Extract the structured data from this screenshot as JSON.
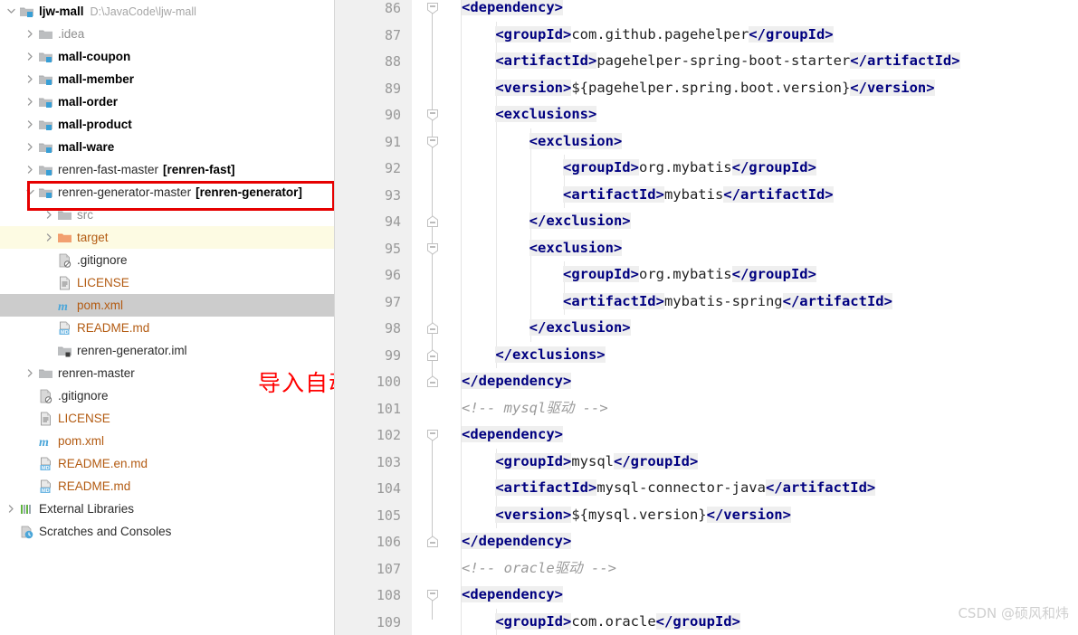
{
  "annotation": {
    "callout_text": "导入自动生成代码的文件",
    "callout_color": "#ff0000",
    "highlight_box_color": "#e60000"
  },
  "watermark": {
    "text": "CSDN @硕风和炜"
  },
  "project_tree": {
    "items": [
      {
        "indent": 0,
        "arrow": "down",
        "icon": "module-folder-icon",
        "label": "ljw-mall",
        "style": "bold",
        "path": "D:\\JavaCode\\ljw-mall",
        "state": "normal"
      },
      {
        "indent": 1,
        "arrow": "right",
        "icon": "folder-icon",
        "label": ".idea",
        "style": "gray",
        "path": "",
        "state": "normal"
      },
      {
        "indent": 1,
        "arrow": "right",
        "icon": "module-folder-icon",
        "label": "mall-coupon",
        "style": "bold",
        "path": "",
        "state": "normal"
      },
      {
        "indent": 1,
        "arrow": "right",
        "icon": "module-folder-icon",
        "label": "mall-member",
        "style": "bold",
        "path": "",
        "state": "normal"
      },
      {
        "indent": 1,
        "arrow": "right",
        "icon": "module-folder-icon",
        "label": "mall-order",
        "style": "bold",
        "path": "",
        "state": "normal"
      },
      {
        "indent": 1,
        "arrow": "right",
        "icon": "module-folder-icon",
        "label": "mall-product",
        "style": "bold",
        "path": "",
        "state": "normal"
      },
      {
        "indent": 1,
        "arrow": "right",
        "icon": "module-folder-icon",
        "label": "mall-ware",
        "style": "bold",
        "path": "",
        "state": "normal"
      },
      {
        "indent": 1,
        "arrow": "right",
        "icon": "module-folder-icon",
        "label": "renren-fast-master",
        "style": "plain",
        "module": "[renren-fast]",
        "path": "",
        "state": "normal"
      },
      {
        "indent": 1,
        "arrow": "down",
        "icon": "module-folder-icon",
        "label": "renren-generator-master",
        "style": "plain",
        "module": "[renren-generator]",
        "path": "",
        "state": "normal"
      },
      {
        "indent": 2,
        "arrow": "right",
        "icon": "folder-icon",
        "label": "src",
        "style": "gray",
        "path": "",
        "state": "normal"
      },
      {
        "indent": 2,
        "arrow": "right",
        "icon": "target-folder-icon",
        "label": "target",
        "style": "orange-folder",
        "path": "",
        "state": "highlight"
      },
      {
        "indent": 2,
        "arrow": "none",
        "icon": "gitignore-icon",
        "label": ".gitignore",
        "style": "plain",
        "path": "",
        "state": "normal"
      },
      {
        "indent": 2,
        "arrow": "none",
        "icon": "text-file-icon",
        "label": "LICENSE",
        "style": "orange",
        "path": "",
        "state": "normal"
      },
      {
        "indent": 2,
        "arrow": "none",
        "icon": "maven-pom-icon",
        "label": "pom.xml",
        "style": "orange",
        "path": "",
        "state": "selected"
      },
      {
        "indent": 2,
        "arrow": "none",
        "icon": "markdown-icon",
        "label": "README.md",
        "style": "orange",
        "path": "",
        "state": "normal"
      },
      {
        "indent": 2,
        "arrow": "none",
        "icon": "iml-icon",
        "label": "renren-generator.iml",
        "style": "plain",
        "path": "",
        "state": "normal"
      },
      {
        "indent": 1,
        "arrow": "right",
        "icon": "folder-icon",
        "label": "renren-master",
        "style": "plain",
        "path": "",
        "state": "normal"
      },
      {
        "indent": 1,
        "arrow": "none",
        "icon": "gitignore-icon",
        "label": ".gitignore",
        "style": "plain",
        "path": "",
        "state": "normal"
      },
      {
        "indent": 1,
        "arrow": "none",
        "icon": "text-file-icon",
        "label": "LICENSE",
        "style": "orange",
        "path": "",
        "state": "normal"
      },
      {
        "indent": 1,
        "arrow": "none",
        "icon": "maven-pom-icon",
        "label": "pom.xml",
        "style": "orange",
        "path": "",
        "state": "normal"
      },
      {
        "indent": 1,
        "arrow": "none",
        "icon": "markdown-icon",
        "label": "README.en.md",
        "style": "orange",
        "path": "",
        "state": "normal"
      },
      {
        "indent": 1,
        "arrow": "none",
        "icon": "markdown-icon",
        "label": "README.md",
        "style": "orange",
        "path": "",
        "state": "normal"
      },
      {
        "indent": 0,
        "arrow": "right",
        "icon": "external-libraries-icon",
        "label": "External Libraries",
        "style": "plain",
        "path": "",
        "state": "normal"
      },
      {
        "indent": 0,
        "arrow": "none",
        "icon": "scratches-icon",
        "label": "Scratches and Consoles",
        "style": "plain",
        "path": "",
        "state": "normal"
      }
    ]
  },
  "editor": {
    "file": "pom.xml",
    "first_line_number": 86,
    "lines": [
      {
        "n": 86,
        "indent": 0,
        "fold": "open",
        "tokens": [
          {
            "t": "tag",
            "v": "<dependency>"
          }
        ]
      },
      {
        "n": 87,
        "indent": 1,
        "fold": "none",
        "tokens": [
          {
            "t": "tag",
            "v": "<groupId>"
          },
          {
            "t": "text",
            "v": "com.github.pagehelper"
          },
          {
            "t": "tag",
            "v": "</groupId>"
          }
        ]
      },
      {
        "n": 88,
        "indent": 1,
        "fold": "none",
        "tokens": [
          {
            "t": "tag",
            "v": "<artifactId>"
          },
          {
            "t": "text",
            "v": "pagehelper-spring-boot-starter"
          },
          {
            "t": "tag",
            "v": "</artifactId>"
          }
        ]
      },
      {
        "n": 89,
        "indent": 1,
        "fold": "none",
        "tokens": [
          {
            "t": "tag",
            "v": "<version>"
          },
          {
            "t": "text",
            "v": "${pagehelper.spring.boot.version}"
          },
          {
            "t": "tag",
            "v": "</version>"
          }
        ]
      },
      {
        "n": 90,
        "indent": 1,
        "fold": "open",
        "tokens": [
          {
            "t": "tag",
            "v": "<exclusions>"
          }
        ]
      },
      {
        "n": 91,
        "indent": 2,
        "fold": "open",
        "tokens": [
          {
            "t": "tag",
            "v": "<exclusion>"
          }
        ]
      },
      {
        "n": 92,
        "indent": 3,
        "fold": "none",
        "tokens": [
          {
            "t": "tag",
            "v": "<groupId>"
          },
          {
            "t": "text",
            "v": "org.mybatis"
          },
          {
            "t": "tag",
            "v": "</groupId>"
          }
        ]
      },
      {
        "n": 93,
        "indent": 3,
        "fold": "none",
        "tokens": [
          {
            "t": "tag",
            "v": "<artifactId>"
          },
          {
            "t": "text",
            "v": "mybatis"
          },
          {
            "t": "tag",
            "v": "</artifactId>"
          }
        ]
      },
      {
        "n": 94,
        "indent": 2,
        "fold": "close",
        "tokens": [
          {
            "t": "tag",
            "v": "</exclusion>"
          }
        ]
      },
      {
        "n": 95,
        "indent": 2,
        "fold": "open",
        "tokens": [
          {
            "t": "tag",
            "v": "<exclusion>"
          }
        ]
      },
      {
        "n": 96,
        "indent": 3,
        "fold": "none",
        "tokens": [
          {
            "t": "tag",
            "v": "<groupId>"
          },
          {
            "t": "text",
            "v": "org.mybatis"
          },
          {
            "t": "tag",
            "v": "</groupId>"
          }
        ]
      },
      {
        "n": 97,
        "indent": 3,
        "fold": "none",
        "tokens": [
          {
            "t": "tag",
            "v": "<artifactId>"
          },
          {
            "t": "text",
            "v": "mybatis-spring"
          },
          {
            "t": "tag",
            "v": "</artifactId>"
          }
        ]
      },
      {
        "n": 98,
        "indent": 2,
        "fold": "close",
        "tokens": [
          {
            "t": "tag",
            "v": "</exclusion>"
          }
        ]
      },
      {
        "n": 99,
        "indent": 1,
        "fold": "close",
        "tokens": [
          {
            "t": "tag",
            "v": "</exclusions>"
          }
        ]
      },
      {
        "n": 100,
        "indent": 0,
        "fold": "close",
        "tokens": [
          {
            "t": "tag",
            "v": "</dependency>"
          }
        ]
      },
      {
        "n": 101,
        "indent": 0,
        "fold": "none",
        "tokens": [
          {
            "t": "comment",
            "v": "<!-- mysql驱动 -->"
          }
        ]
      },
      {
        "n": 102,
        "indent": 0,
        "fold": "open",
        "tokens": [
          {
            "t": "tag",
            "v": "<dependency>"
          }
        ]
      },
      {
        "n": 103,
        "indent": 1,
        "fold": "none",
        "tokens": [
          {
            "t": "tag",
            "v": "<groupId>"
          },
          {
            "t": "text",
            "v": "mysql"
          },
          {
            "t": "tag",
            "v": "</groupId>"
          }
        ]
      },
      {
        "n": 104,
        "indent": 1,
        "fold": "none",
        "tokens": [
          {
            "t": "tag",
            "v": "<artifactId>"
          },
          {
            "t": "text",
            "v": "mysql-connector-java"
          },
          {
            "t": "tag",
            "v": "</artifactId>"
          }
        ]
      },
      {
        "n": 105,
        "indent": 1,
        "fold": "none",
        "tokens": [
          {
            "t": "tag",
            "v": "<version>"
          },
          {
            "t": "text",
            "v": "${mysql.version}"
          },
          {
            "t": "tag",
            "v": "</version>"
          }
        ]
      },
      {
        "n": 106,
        "indent": 0,
        "fold": "close",
        "tokens": [
          {
            "t": "tag",
            "v": "</dependency>"
          }
        ]
      },
      {
        "n": 107,
        "indent": 0,
        "fold": "none",
        "tokens": [
          {
            "t": "comment",
            "v": "<!-- oracle驱动 -->"
          }
        ]
      },
      {
        "n": 108,
        "indent": 0,
        "fold": "open",
        "tokens": [
          {
            "t": "tag",
            "v": "<dependency>"
          }
        ]
      },
      {
        "n": 109,
        "indent": 1,
        "fold": "none",
        "tokens": [
          {
            "t": "tag",
            "v": "<groupId>"
          },
          {
            "t": "text",
            "v": "com.oracle"
          },
          {
            "t": "tag",
            "v": "</groupId>"
          }
        ]
      }
    ]
  },
  "colors": {
    "tag": "#000080",
    "tag_bg": "#efefef",
    "text": "#222222",
    "comment": "#9a9a9a",
    "gutter_bg": "#f0f0f0",
    "line_number": "#999999",
    "selection": "#cccccc",
    "highlight_row": "#fdfbe3",
    "folder_orange": "#f2935c",
    "folder_gray": "#afb1b3",
    "module_blue": "#389fd6"
  }
}
